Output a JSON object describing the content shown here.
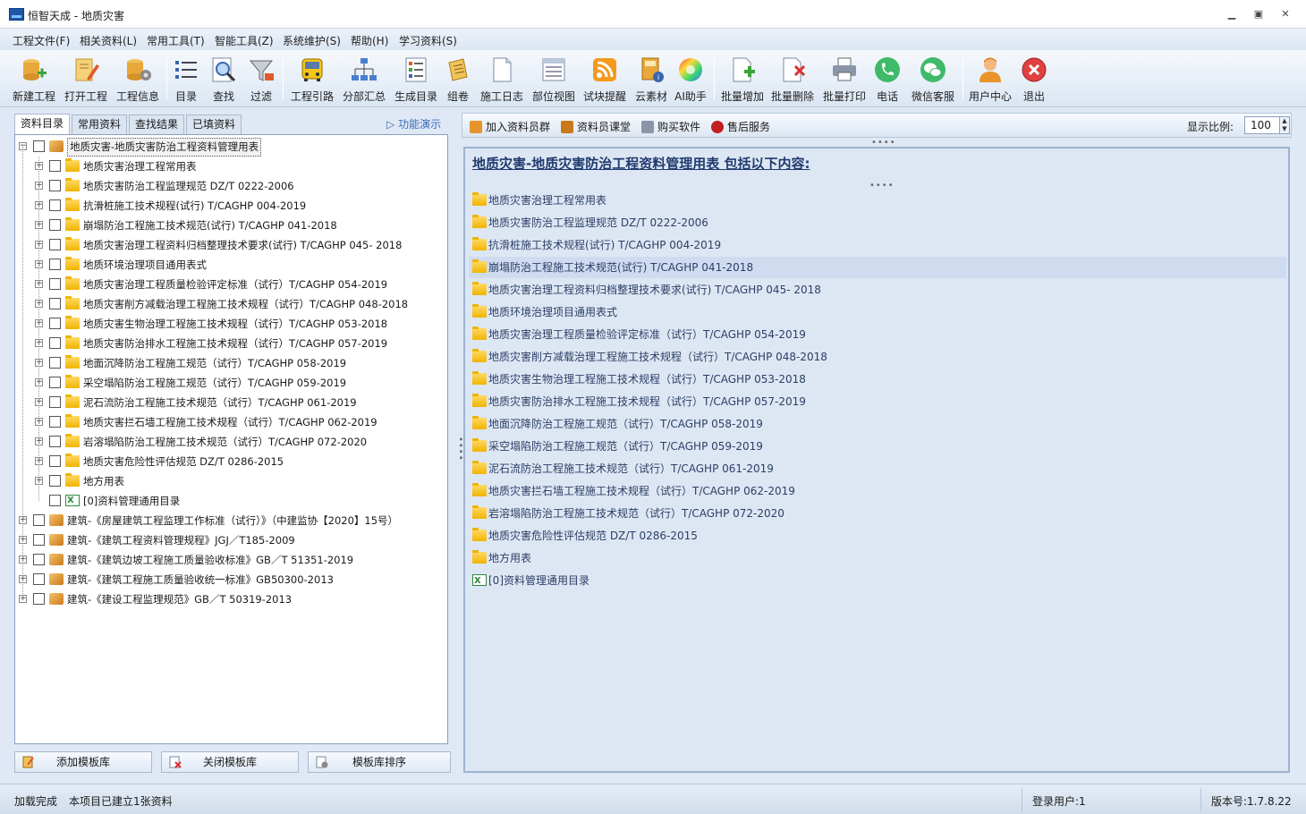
{
  "window": {
    "title": "恒智天成 - 地质灾害"
  },
  "menu": [
    "工程文件(F)",
    "相关资料(L)",
    "常用工具(T)",
    "智能工具(Z)",
    "系统维护(S)",
    "帮助(H)",
    "学习资料(S)"
  ],
  "toolbar": [
    {
      "label": "新建工程",
      "icon": "new-project-icon"
    },
    {
      "label": "打开工程",
      "icon": "open-project-icon"
    },
    {
      "label": "工程信息",
      "icon": "project-info-icon"
    },
    {
      "label": "目录",
      "icon": "list-icon"
    },
    {
      "label": "查找",
      "icon": "search-icon"
    },
    {
      "label": "过滤",
      "icon": "filter-icon"
    },
    {
      "label": "工程引路",
      "icon": "bus-icon"
    },
    {
      "label": "分部汇总",
      "icon": "hierarchy-icon"
    },
    {
      "label": "生成目录",
      "icon": "generate-list-icon"
    },
    {
      "label": "组卷",
      "icon": "volume-icon"
    },
    {
      "label": "施工日志",
      "icon": "log-icon"
    },
    {
      "label": "部位视图",
      "icon": "view-icon"
    },
    {
      "label": "试块提醒",
      "icon": "rss-icon"
    },
    {
      "label": "云素材",
      "icon": "cloud-material-icon"
    },
    {
      "label": "AI助手",
      "icon": "ai-color-icon"
    },
    {
      "label": "批量增加",
      "icon": "batch-add-icon"
    },
    {
      "label": "批量删除",
      "icon": "batch-delete-icon"
    },
    {
      "label": "批量打印",
      "icon": "print-icon"
    },
    {
      "label": "电话",
      "icon": "phone-icon"
    },
    {
      "label": "微信客服",
      "icon": "wechat-icon"
    },
    {
      "label": "用户中心",
      "icon": "user-icon"
    },
    {
      "label": "退出",
      "icon": "exit-icon"
    }
  ],
  "left": {
    "tabs": [
      "资料目录",
      "常用资料",
      "查找结果",
      "已填资料"
    ],
    "demo": "功能演示",
    "root": "地质灾害-地质灾害防治工程资料管理用表",
    "children": [
      "地质灾害治理工程常用表",
      "地质灾害防治工程监理规范 DZ/T 0222-2006",
      "抗滑桩施工技术规程(试行) T/CAGHP 004-2019",
      "崩塌防治工程施工技术规范(试行) T/CAGHP 041-2018",
      "地质灾害治理工程资料归档整理技术要求(试行) T/CAGHP 045- 2018",
      "地质环境治理项目通用表式",
      "地质灾害治理工程质量检验评定标准（试行）T/CAGHP 054-2019",
      "地质灾害削方减载治理工程施工技术规程（试行）T/CAGHP 048-2018",
      "地质灾害生物治理工程施工技术规程（试行）T/CAGHP 053-2018",
      "地质灾害防治排水工程施工技术规程（试行）T/CAGHP 057-2019",
      "地面沉降防治工程施工规范（试行）T/CAGHP 058-2019",
      "采空塌陷防治工程施工规范（试行）T/CAGHP 059-2019",
      "泥石流防治工程施工技术规范（试行）T/CAGHP 061-2019",
      "地质灾害拦石墙工程施工技术规程（试行）T/CAGHP 062-2019",
      "岩溶塌陷防治工程施工技术规范（试行）T/CAGHP 072-2020",
      "地质灾害危险性评估规范 DZ/T 0286-2015",
      "地方用表"
    ],
    "file_child": "[0]资料管理通用目录",
    "others": [
      "建筑-《房屋建筑工程监理工作标准（试行）》（中建监协【2020】15号）",
      "建筑-《建筑工程资料管理规程》JGJ／T185-2009",
      "建筑-《建筑边坡工程施工质量验收标准》GB／T 51351-2019",
      "建筑-《建筑工程施工质量验收统一标准》GB50300-2013",
      "建筑-《建设工程监理规范》GB／T 50319-2013"
    ],
    "buttons": [
      "添加模板库",
      "关闭模板库",
      "模板库排序"
    ]
  },
  "right": {
    "toolbar": [
      "加入资料员群",
      "资料员课堂",
      "购买软件",
      "售后服务"
    ],
    "zoom_label": "显示比例:",
    "zoom_value": "100",
    "title": "地质灾害-地质灾害防治工程资料管理用表 包括以下内容:",
    "highlight_index": 3
  },
  "status": {
    "left": "加载完成",
    "info": "本项目已建立1张资料",
    "user": "登录用户:1",
    "version": "版本号:1.7.8.22"
  },
  "colors": {
    "accent": "#1f3a6e",
    "highlight": "#cfdcf0",
    "folder": "#f0b400"
  }
}
